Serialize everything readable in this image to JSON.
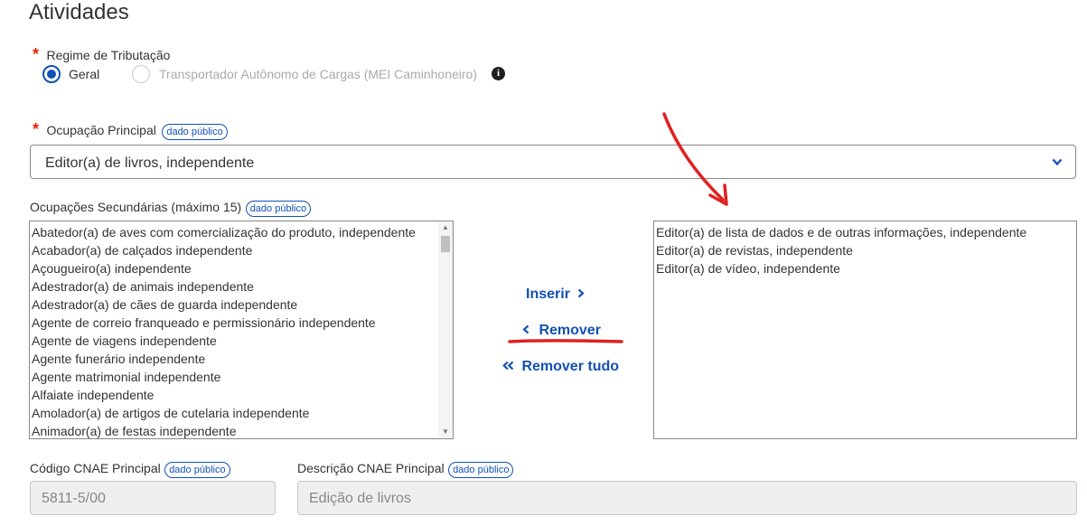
{
  "section_title": "Atividades",
  "regime": {
    "required_mark": "*",
    "label": "Regime de Tributação",
    "options": [
      {
        "label": "Geral",
        "selected": true
      },
      {
        "label": "Transportador Autônomo de Cargas (MEI Caminhoneiro)",
        "selected": false
      }
    ],
    "info_icon": "info-icon"
  },
  "ocupacao_principal": {
    "required_mark": "*",
    "label": "Ocupação Principal",
    "badge": "dado público",
    "value": "Editor(a) de livros, independente"
  },
  "ocupacoes_secundarias": {
    "label": "Ocupações Secundárias (máximo 15)",
    "badge": "dado público",
    "available": [
      "Abatedor(a) de aves com comercialização do produto, independente",
      "Acabador(a) de calçados independente",
      "Açougueiro(a) independente",
      "Adestrador(a) de animais independente",
      "Adestrador(a) de cães de guarda independente",
      "Agente de correio franqueado e permissionário independente",
      "Agente de viagens independente",
      "Agente funerário independente",
      "Agente matrimonial independente",
      "Alfaiate independente",
      "Amolador(a) de artigos de cutelaria independente",
      "Animador(a) de festas independente"
    ],
    "selected": [
      "Editor(a) de lista de dados e de outras informações, independente",
      "Editor(a) de revistas, independente",
      "Editor(a) de vídeo, independente"
    ],
    "buttons": {
      "insert": "Inserir",
      "remove": "Remover",
      "remove_all": "Remover tudo"
    }
  },
  "cnae": {
    "codigo_label": "Código CNAE Principal",
    "codigo_badge": "dado público",
    "codigo_value": "5811-5/00",
    "descricao_label": "Descrição CNAE Principal",
    "descricao_badge": "dado público",
    "descricao_value": "Edição de livros"
  },
  "colors": {
    "primary": "#1351b4",
    "required": "#e52207",
    "annotation": "#e02020"
  }
}
